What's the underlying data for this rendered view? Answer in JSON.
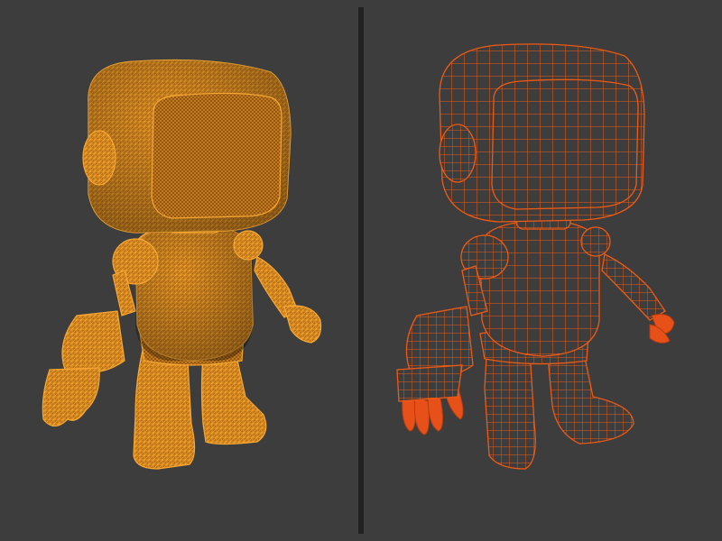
{
  "colors": {
    "background": "#3d3d3d",
    "divider": "#222222",
    "dense_mesh": "#f39a1e",
    "dense_mesh_fill": "#c8791a",
    "quad_mesh": "#ee5a14",
    "quad_mesh_fill": "#3d3d3d",
    "quad_mesh_solid": "#e8501a"
  },
  "panels": [
    {
      "id": "left",
      "subject": "robot-dense-triangulated-wireframe"
    },
    {
      "id": "right",
      "subject": "robot-quad-topology-wireframe"
    }
  ]
}
